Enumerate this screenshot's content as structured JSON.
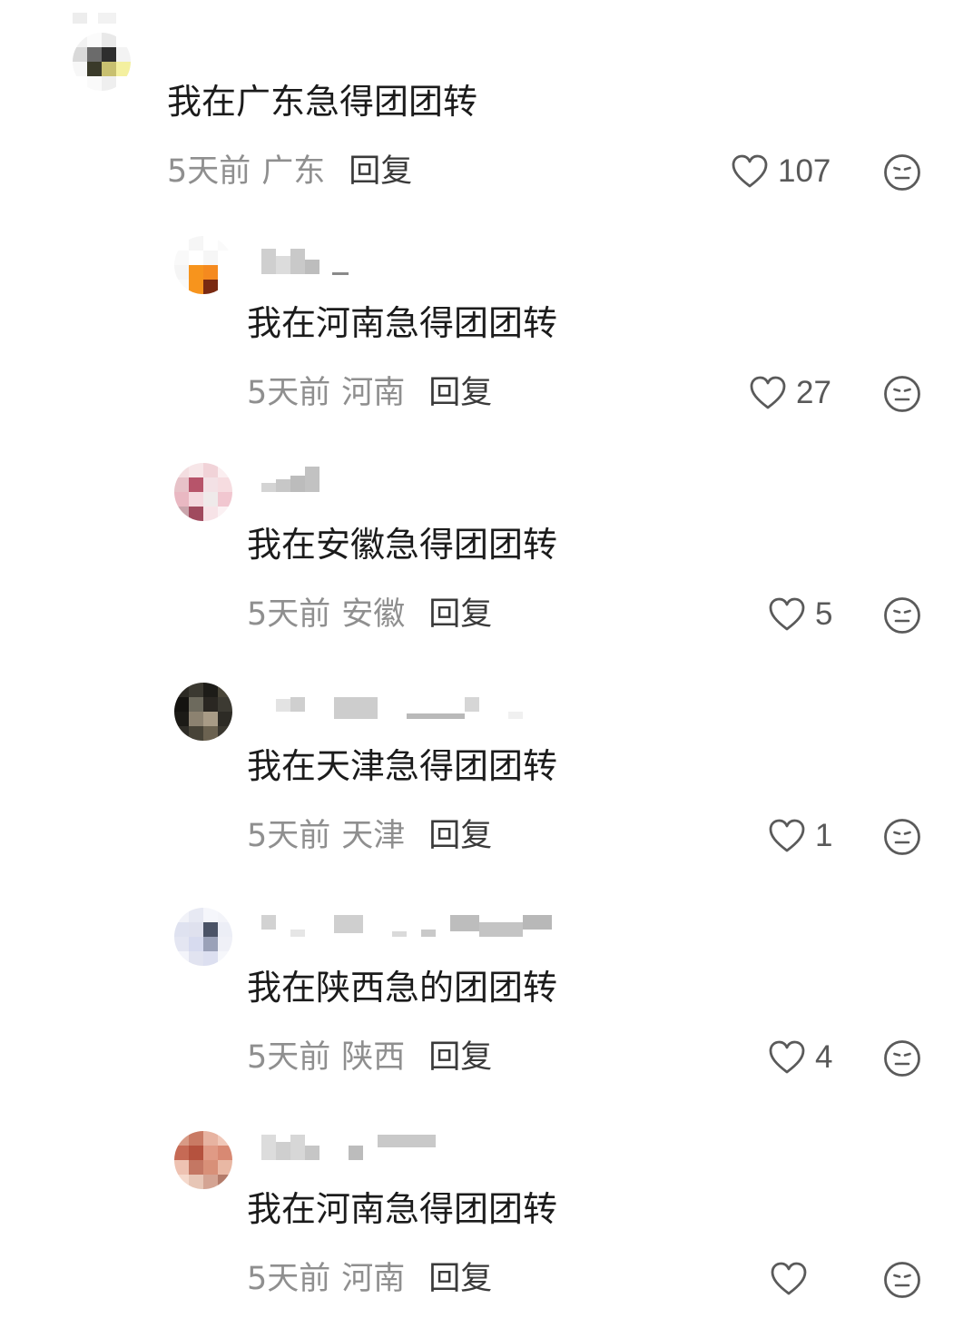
{
  "comments": [
    {
      "id": "c0",
      "level": "top",
      "text": "我在广东急得团团转",
      "time": "5天前",
      "location": "广东",
      "reply_label": "回复",
      "likes": "107",
      "avatar_colors": [
        "#f2f2f2",
        "#fbfbfb",
        "#e9e9e9",
        "#ffffff",
        "#d9d9d9",
        "#6b6b6b",
        "#2e2e2e",
        "#f3f3f3",
        "#f7f7f7",
        "#3a3a2a",
        "#c8c070",
        "#f4f0a0",
        "#ffffff",
        "#fafafa",
        "#efefef",
        "#ffffff"
      ]
    },
    {
      "id": "c1",
      "level": "reply",
      "text": "我在河南急得团团转",
      "time": "5天前",
      "location": "河南",
      "reply_label": "回复",
      "likes": "27",
      "avatar_colors": [
        "#ffffff",
        "#f6f6f6",
        "#ffffff",
        "#fafafa",
        "#f9f9f9",
        "#ffffff",
        "#f6f6f6",
        "#ffffff",
        "#f5f5f5",
        "#f7941d",
        "#f58a1f",
        "#ffffff",
        "#fafafa",
        "#f7941d",
        "#7a2a12",
        "#ffffff"
      ]
    },
    {
      "id": "c2",
      "level": "reply",
      "text": "我在安徽急得团团转",
      "time": "5天前",
      "location": "安徽",
      "reply_label": "回复",
      "likes": "5",
      "avatar_colors": [
        "#f3dde0",
        "#f7e6e8",
        "#f1d3d8",
        "#fbeef0",
        "#e7c2c8",
        "#b7546a",
        "#f3e1e5",
        "#f6dce0",
        "#e9b8c2",
        "#f4d8de",
        "#efeaea",
        "#f1c7d0",
        "#c9a4ab",
        "#a04a5e",
        "#f7e3e7",
        "#fbf1f3"
      ]
    },
    {
      "id": "c3",
      "level": "reply",
      "text": "我在天津急得团团转",
      "time": "5天前",
      "location": "天津",
      "reply_label": "回复",
      "likes": "1",
      "avatar_colors": [
        "#2c2a24",
        "#3b3931",
        "#1d1c18",
        "#4a4639",
        "#141310",
        "#6d6a5d",
        "#2a2722",
        "#3c3a32",
        "#1b1a16",
        "#8c8270",
        "#a89b86",
        "#2d2b25",
        "#2e2c26",
        "#474337",
        "#6b6250",
        "#3a372f"
      ]
    },
    {
      "id": "c4",
      "level": "reply",
      "text": "我在陕西急的团团转",
      "time": "5天前",
      "location": "陕西",
      "reply_label": "回复",
      "likes": "4",
      "avatar_colors": [
        "#f1f2f8",
        "#e7e9f3",
        "#f5f6fb",
        "#f3f4f9",
        "#dfe2f0",
        "#dfe1ee",
        "#4b5366",
        "#eceef6",
        "#e4e6f2",
        "#d7dbef",
        "#9aa1b8",
        "#eff0f7",
        "#f3f4fa",
        "#e1e3f0",
        "#dcdff0",
        "#f6f7fb"
      ]
    },
    {
      "id": "c5",
      "level": "reply",
      "text": "我在河南急得团团转",
      "time": "5天前",
      "location": "河南",
      "reply_label": "回复",
      "likes": "",
      "avatar_colors": [
        "#d89a85",
        "#c97a64",
        "#e7b3a1",
        "#f0c7b8",
        "#c66a55",
        "#b5523e",
        "#e09a85",
        "#d88973",
        "#eec2b2",
        "#c47763",
        "#d89078",
        "#e9b8a4",
        "#f5d9cc",
        "#e7c6b6",
        "#d4a493",
        "#b47b6a"
      ]
    }
  ],
  "icons": {
    "like": "heart-outline-icon",
    "dislike": "meh-face-icon"
  },
  "colors": {
    "text": "#1b1b1b",
    "meta": "#8f8f8f",
    "reply": "#3a3a3a",
    "icon": "#5a5a5a"
  }
}
